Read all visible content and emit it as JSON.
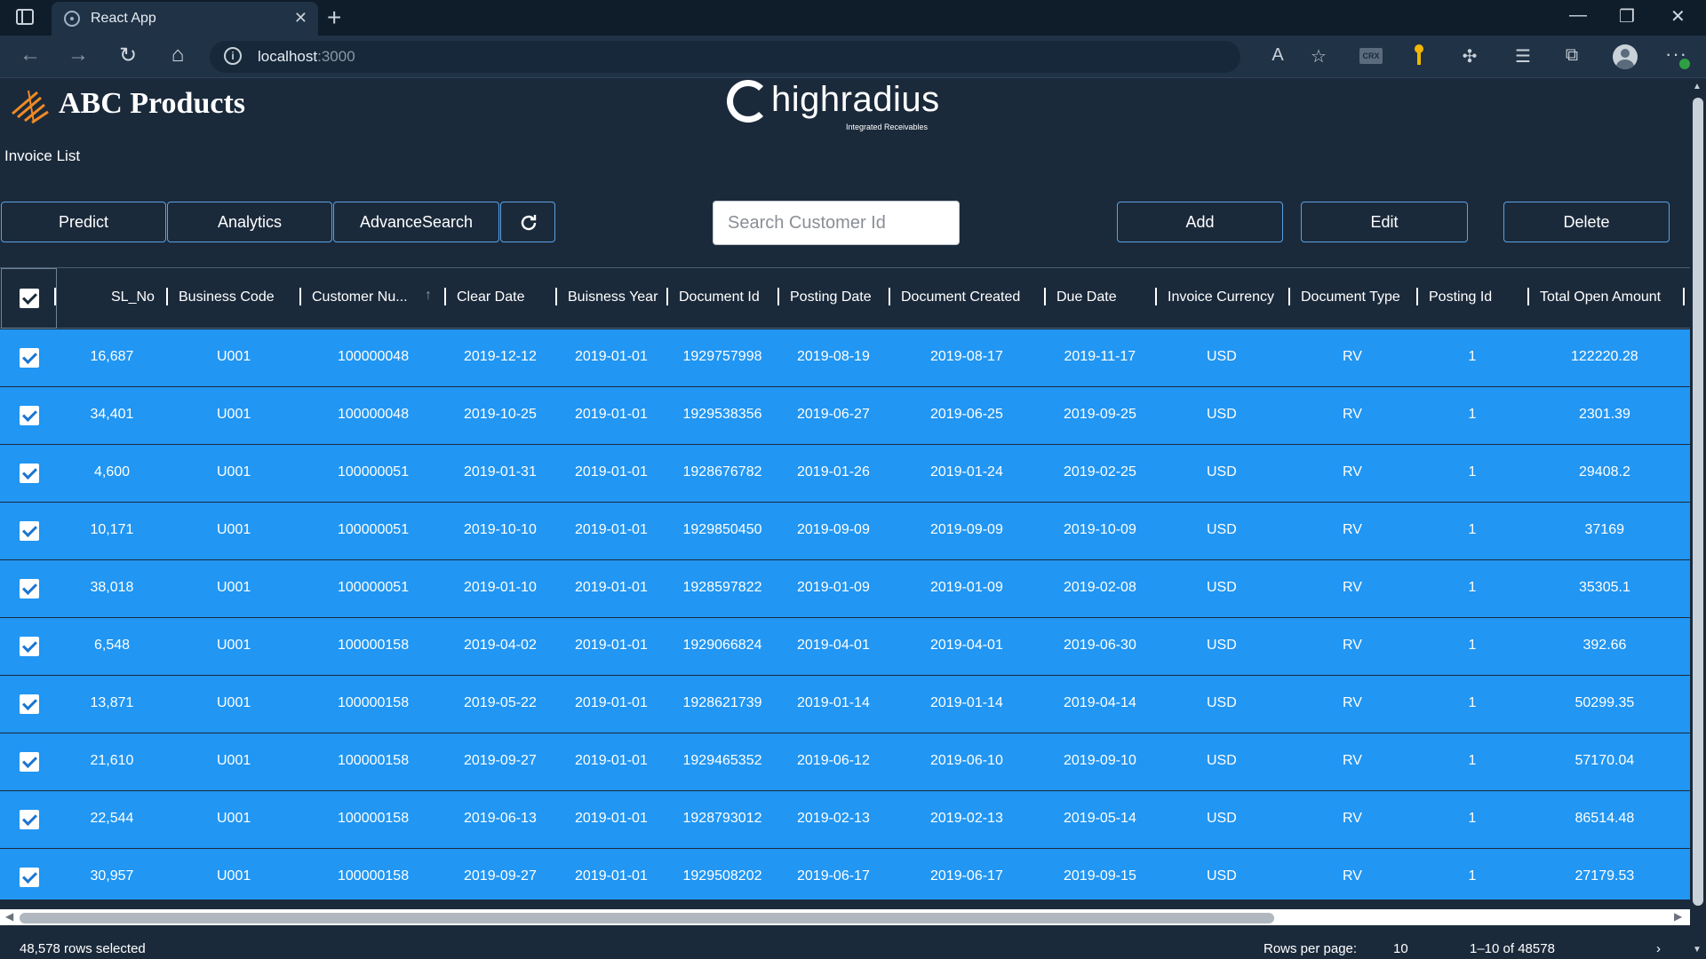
{
  "browser": {
    "tab_title": "React App",
    "url_host": "localhost",
    "url_port": ":3000",
    "new_tab": "+",
    "close_tab": "✕"
  },
  "app": {
    "brand": "ABC Products",
    "partner_logo": "highradius",
    "partner_tagline": "Integrated Receivables",
    "page_title": "Invoice List"
  },
  "toolbar": {
    "predict": "Predict",
    "analytics": "Analytics",
    "advance_search": "AdvanceSearch",
    "add": "Add",
    "edit": "Edit",
    "delete": "Delete",
    "search_placeholder": "Search Customer Id"
  },
  "table": {
    "columns": [
      "SL_No",
      "Business Code",
      "Customer Nu...",
      "Clear Date",
      "Buisness Year",
      "Document Id",
      "Posting Date",
      "Document Created",
      "Due Date",
      "Invoice Currency",
      "Document Type",
      "Posting Id",
      "Total Open Amount"
    ],
    "rows": [
      [
        "16,687",
        "U001",
        "100000048",
        "2019-12-12",
        "2019-01-01",
        "1929757998",
        "2019-08-19",
        "2019-08-17",
        "2019-11-17",
        "USD",
        "RV",
        "1",
        "122220.28"
      ],
      [
        "34,401",
        "U001",
        "100000048",
        "2019-10-25",
        "2019-01-01",
        "1929538356",
        "2019-06-27",
        "2019-06-25",
        "2019-09-25",
        "USD",
        "RV",
        "1",
        "2301.39"
      ],
      [
        "4,600",
        "U001",
        "100000051",
        "2019-01-31",
        "2019-01-01",
        "1928676782",
        "2019-01-26",
        "2019-01-24",
        "2019-02-25",
        "USD",
        "RV",
        "1",
        "29408.2"
      ],
      [
        "10,171",
        "U001",
        "100000051",
        "2019-10-10",
        "2019-01-01",
        "1929850450",
        "2019-09-09",
        "2019-09-09",
        "2019-10-09",
        "USD",
        "RV",
        "1",
        "37169"
      ],
      [
        "38,018",
        "U001",
        "100000051",
        "2019-01-10",
        "2019-01-01",
        "1928597822",
        "2019-01-09",
        "2019-01-09",
        "2019-02-08",
        "USD",
        "RV",
        "1",
        "35305.1"
      ],
      [
        "6,548",
        "U001",
        "100000158",
        "2019-04-02",
        "2019-01-01",
        "1929066824",
        "2019-04-01",
        "2019-04-01",
        "2019-06-30",
        "USD",
        "RV",
        "1",
        "392.66"
      ],
      [
        "13,871",
        "U001",
        "100000158",
        "2019-05-22",
        "2019-01-01",
        "1928621739",
        "2019-01-14",
        "2019-01-14",
        "2019-04-14",
        "USD",
        "RV",
        "1",
        "50299.35"
      ],
      [
        "21,610",
        "U001",
        "100000158",
        "2019-09-27",
        "2019-01-01",
        "1929465352",
        "2019-06-12",
        "2019-06-10",
        "2019-09-10",
        "USD",
        "RV",
        "1",
        "57170.04"
      ],
      [
        "22,544",
        "U001",
        "100000158",
        "2019-06-13",
        "2019-01-01",
        "1928793012",
        "2019-02-13",
        "2019-02-13",
        "2019-05-14",
        "USD",
        "RV",
        "1",
        "86514.48"
      ],
      [
        "30,957",
        "U001",
        "100000158",
        "2019-09-27",
        "2019-01-01",
        "1929508202",
        "2019-06-17",
        "2019-06-17",
        "2019-09-15",
        "USD",
        "RV",
        "1",
        "27179.53"
      ]
    ]
  },
  "footer": {
    "selected": "48,578 rows selected",
    "rows_per_page_label": "Rows per page:",
    "rows_per_page": "10",
    "range": "1–10 of 48578"
  },
  "colors": {
    "background": "#1b2a3b",
    "row_selected": "#2196f3",
    "button_border": "#5aa1e3"
  }
}
